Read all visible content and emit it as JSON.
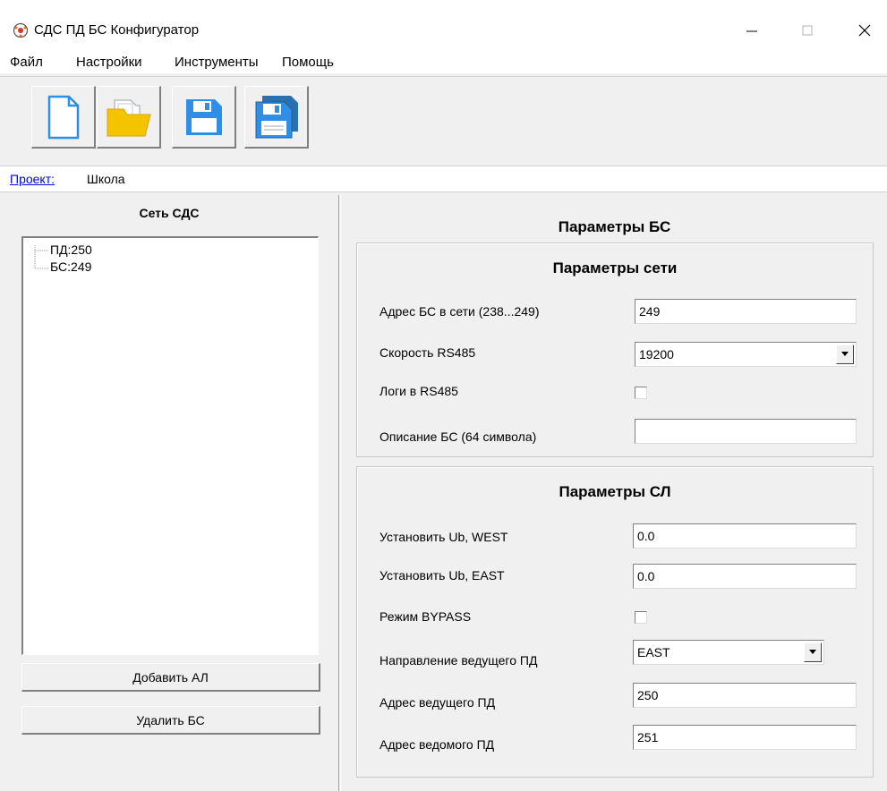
{
  "window": {
    "title": "СДС ПД БС Конфигуратор",
    "minimize_icon": "minimize-icon",
    "maximize_icon": "maximize-icon",
    "close_icon": "close-icon"
  },
  "menu": {
    "items": [
      "Файл",
      "Настройки",
      "Инструменты",
      "Помощь"
    ]
  },
  "toolbar": {
    "buttons": [
      "new-file-icon",
      "open-folder-icon",
      "save-icon",
      "save-as-icon"
    ],
    "colors": {
      "folder": "#f5c400",
      "save": "#2f8ee5",
      "save_dark": "#2a6fb0"
    }
  },
  "project": {
    "label": "Проект:",
    "value": "Школа"
  },
  "left": {
    "title": "Сеть СДС",
    "tree": [
      "ПД:250",
      "БС:249"
    ],
    "add_button": "Добавить АЛ",
    "delete_button": "Удалить БС"
  },
  "right": {
    "title": "Параметры БС",
    "network": {
      "title": "Параметры сети",
      "address_label": "Адрес  БС в сети (238...249)",
      "address_value": "249",
      "speed_label": "Скорость RS485",
      "speed_value": "19200",
      "logs_label": "Логи в RS485",
      "logs_checked": false,
      "description_label": "Описание БС (64 символа)",
      "description_value": ""
    },
    "line": {
      "title": "Параметры СЛ",
      "ub_west_label": "Установить Ub, WEST",
      "ub_west_value": "0.0",
      "ub_east_label": "Установить Ub, EAST",
      "ub_east_value": "0.0",
      "bypass_label": "Режим BYPASS",
      "bypass_checked": false,
      "direction_label": "Направление ведущего ПД",
      "direction_value": "EAST",
      "master_label": "Адрес ведущего ПД",
      "master_value": "250",
      "slave_label": "Адрес ведомого ПД",
      "slave_value": "251"
    }
  }
}
